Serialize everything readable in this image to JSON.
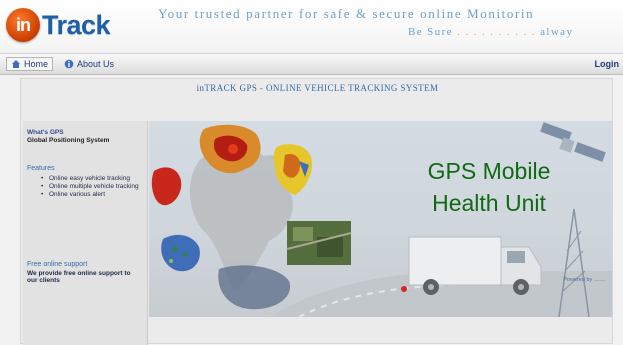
{
  "header": {
    "logo_badge": "in",
    "logo_word": "Track",
    "tagline": "Your trusted partner for safe & secure online Monitorin",
    "tagline2_a": "Be Sure ",
    "tagline2_dots": ". . . . . . . . . .",
    "tagline2_b": " alway"
  },
  "nav": {
    "home_label": "Home",
    "about_label": "About Us",
    "login_label": "Login"
  },
  "content": {
    "title": "inTRACK GPS - ONLINE VEHICLE TRACKING SYSTEM",
    "left": {
      "whats_gps": "What's GPS",
      "gps_full": "Global Positioning System",
      "features_heading": "Features",
      "features": [
        "Online easy vehicle tracking",
        "Online multiple vehicle tracking",
        "Online various alert"
      ],
      "support_heading": "Free online support",
      "support_text": "We provide free online support to our clients"
    },
    "hero": {
      "title_line1": "GPS Mobile",
      "title_line2": "Health Unit",
      "caption": "Powered by ........"
    }
  },
  "colors": {
    "accent": "#1f5fa8",
    "hero_text": "#106a14",
    "logo_orange": "#d94a00"
  }
}
